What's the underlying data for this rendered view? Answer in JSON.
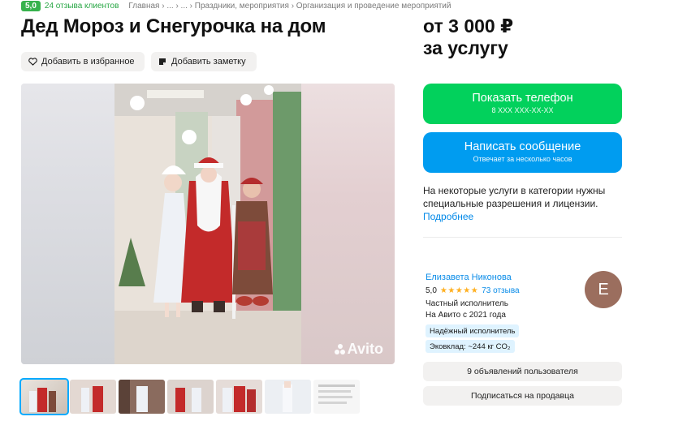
{
  "header": {
    "rating_value": "5,0",
    "reviews_link": "24 отзыва клиентов",
    "breadcrumbs": "Главная › ... › ... › Праздники, мероприятия › Организация и проведение мероприятий"
  },
  "title": "Дед Мороз и Снегурочка на дом",
  "actions": {
    "favorite_label": "Добавить в избранное",
    "note_label": "Добавить заметку"
  },
  "gallery": {
    "watermark": "Avito",
    "thumbnail_count": 7,
    "active_thumbnail": 0
  },
  "price": {
    "line1": "от 3 000 ₽",
    "line2": "за услугу"
  },
  "contact": {
    "phone_title": "Показать телефон",
    "phone_masked": "8 XXX XXX-XX-XX",
    "message_title": "Написать сообщение",
    "message_subtitle": "Отвечает за несколько часов"
  },
  "notice": {
    "text": "На некоторые услуги в категории нужны специальные разрешения и лицензии.",
    "more_link": "Подробнее"
  },
  "seller": {
    "name": "Елизавета Никонова",
    "rating": "5,0",
    "stars": "★★★★★",
    "reviews": "73 отзыва",
    "type": "Частный исполнитель",
    "since": "На Авито с 2021 года",
    "avatar_letter": "Е",
    "badge_trusted": "Надёжный исполнитель",
    "badge_eco": "Эковклад: ~244 кг CO₂",
    "ads_button": "9 объявлений пользователя",
    "subscribe_button": "Подписаться на продавца"
  },
  "colors": {
    "phone_button": "#02d15c",
    "message_button": "#009cf0",
    "link": "#0a8ce8",
    "rating_badge": "#37b24d",
    "avatar": "#9b6e5e"
  }
}
